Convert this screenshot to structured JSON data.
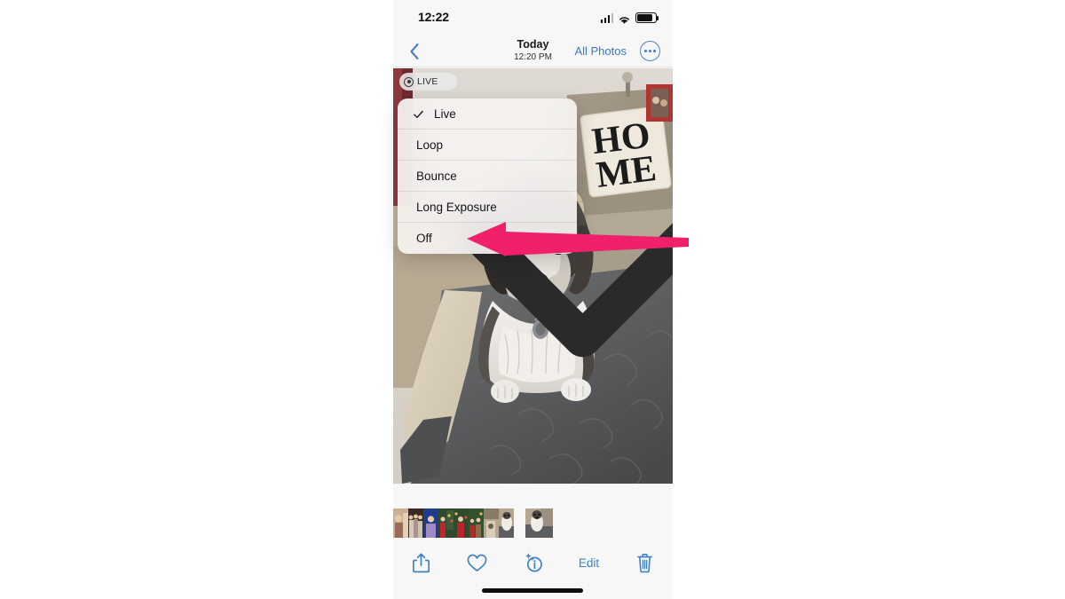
{
  "app": {
    "name": "Photos",
    "platform": "iOS"
  },
  "status_bar": {
    "time": "12:22",
    "cellular_icon": "cellular-signal-icon",
    "wifi_icon": "wifi-icon",
    "battery_icon": "battery-icon"
  },
  "nav_bar": {
    "back_icon": "chevron-left-icon",
    "title": "Today",
    "subtitle": "12:20 PM",
    "all_photos_label": "All Photos",
    "more_icon": "ellipsis-circle-icon"
  },
  "live_badge": {
    "icon": "live-photo-icon",
    "label": "LIVE",
    "chevron_icon": "chevron-down-icon",
    "expanded": true
  },
  "menu": {
    "selected": "Live",
    "check_icon": "checkmark-icon",
    "items": [
      {
        "label": "Live",
        "checked": true
      },
      {
        "label": "Loop",
        "checked": false
      },
      {
        "label": "Bounce",
        "checked": false
      },
      {
        "label": "Long Exposure",
        "checked": false
      },
      {
        "label": "Off",
        "checked": false
      }
    ]
  },
  "annotation": {
    "type": "arrow",
    "direction": "left",
    "color": "#f0206a",
    "points_to": "Off"
  },
  "photo": {
    "description": "Small white and gray terrier dog sitting on a gray blanket in front of a beige couch with a HOME pillow",
    "pillow_text_line1": "HO",
    "pillow_text_line2": "ME"
  },
  "thumbnail_strip": {
    "count": 9,
    "selected_index": 8
  },
  "toolbar": {
    "share_icon": "share-icon",
    "favorite_icon": "heart-icon",
    "info_icon": "info-sparkle-icon",
    "edit_label": "Edit",
    "delete_icon": "trash-icon"
  },
  "home_indicator": "home-indicator",
  "colors": {
    "accent_blue": "#3e82c4",
    "annotation_pink": "#f0206a",
    "chrome_gray": "#f7f7f7",
    "menu_bg": "#f4f2f0"
  }
}
